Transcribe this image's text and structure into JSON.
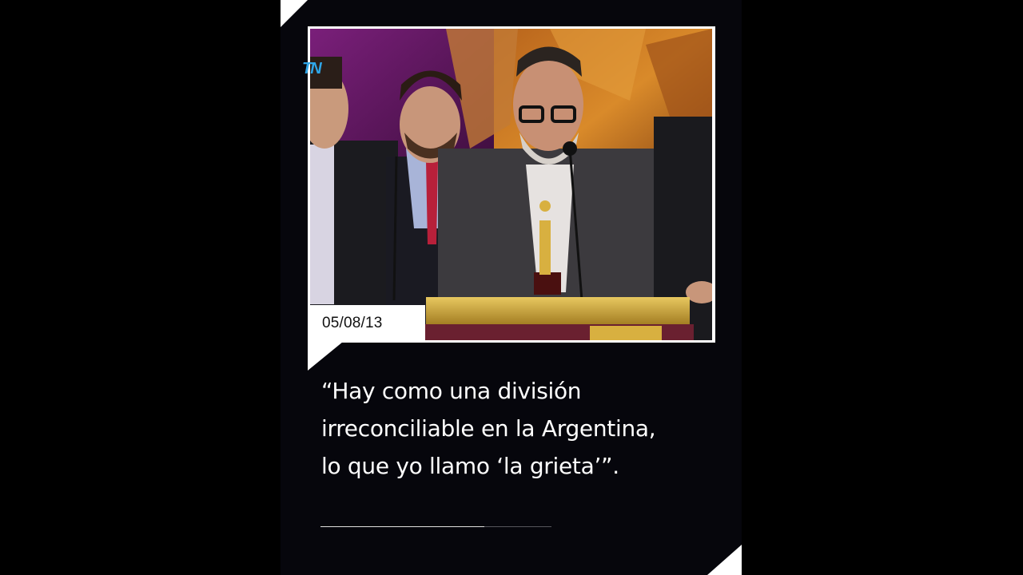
{
  "video": {
    "channel_logo": "TN",
    "date": "05/08/13",
    "quote_lines": [
      "“Hay como una división",
      "irreconciliable en la Argentina,",
      "lo que yo llamo ‘la grieta’”."
    ],
    "progress": 0.71
  },
  "colors": {
    "background": "#000000",
    "frame_background": "#06060c",
    "text": "#ffffff",
    "logo_blue": "#2fa6e8",
    "logo_red": "#e8334a"
  }
}
